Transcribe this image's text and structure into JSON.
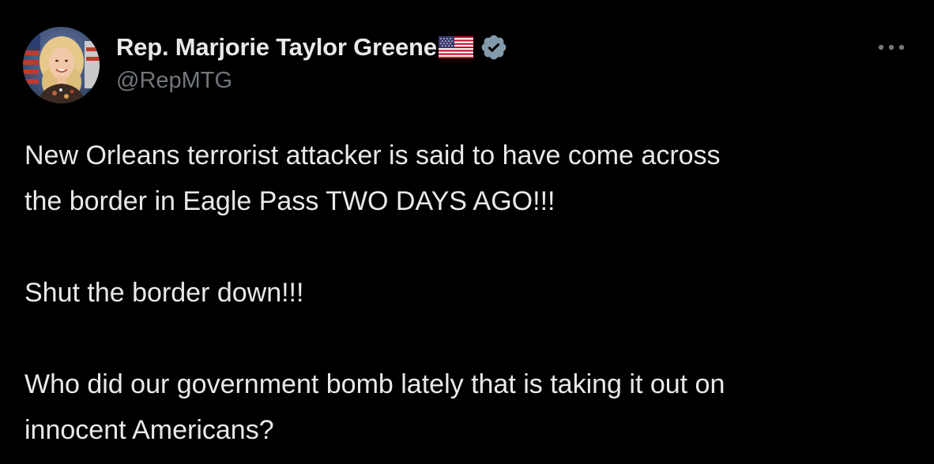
{
  "author": {
    "display_name": "Rep. Marjorie Taylor Greene",
    "handle": "@RepMTG",
    "avatar_icon": "profile-photo",
    "flag_icon": "us-flag-emoji",
    "verified_icon": "verified-badge",
    "verified_color": "#829aab"
  },
  "actions": {
    "more_icon": "more-horizontal-icon"
  },
  "tweet": {
    "paragraphs": [
      {
        "lines": [
          "New Orleans terrorist attacker is said to have come across",
          "the border in Eagle Pass TWO DAYS AGO!!!"
        ]
      },
      {
        "lines": [
          "Shut the border down!!!"
        ]
      },
      {
        "lines": [
          "Who did our government bomb lately that is taking it out on",
          "innocent Americans?"
        ]
      }
    ]
  },
  "colors": {
    "background": "#000000",
    "text_primary": "#e7e9ea",
    "text_secondary": "#71767b"
  }
}
